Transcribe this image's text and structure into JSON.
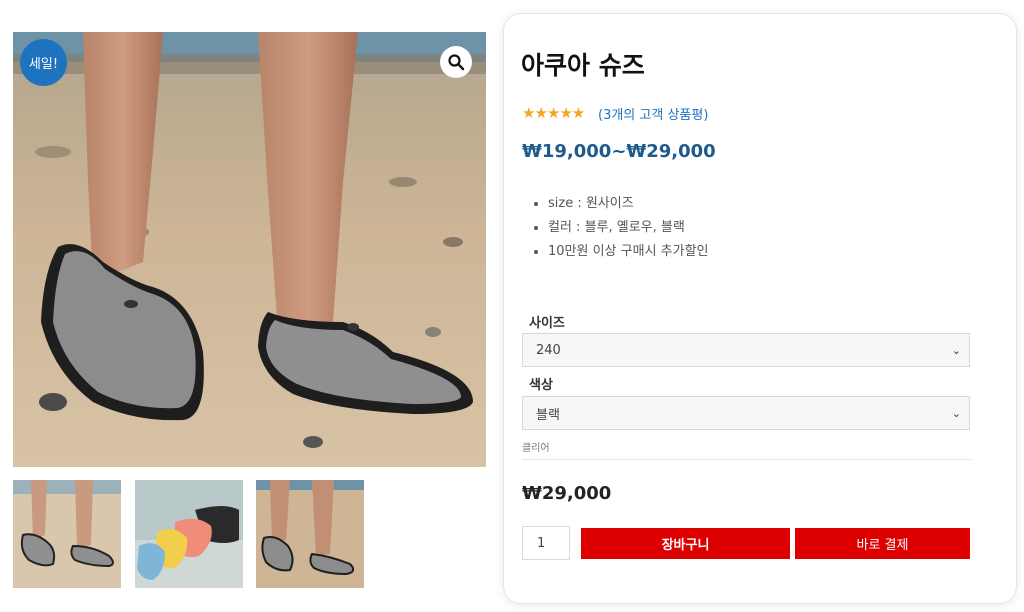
{
  "gallery": {
    "sale_badge": "세일!",
    "zoom_icon": "magnifier-icon",
    "main_image_alt": "aqua-shoes-beach-photo",
    "thumbnails": [
      "thumb-1",
      "thumb-2",
      "thumb-3"
    ]
  },
  "product": {
    "title": "아쿠아 슈즈",
    "rating": {
      "stars": "★★★★★",
      "value": 5,
      "max": 5,
      "review_text": "(3개의 고객 상품평)"
    },
    "price_range": "₩19,000~₩29,000",
    "features": [
      "size : 원사이즈",
      "컬러 : 블루, 옐로우, 블랙",
      "10만원 이상 구매시 추가할인"
    ]
  },
  "variations": {
    "size_label": "사이즈",
    "size_value": "240",
    "color_label": "색상",
    "color_value": "블랙",
    "clear_label": "클리어"
  },
  "purchase": {
    "price": "₩29,000",
    "quantity": "1",
    "cart_button": "장바구니",
    "buy_button": "바로 결제"
  },
  "colors": {
    "accent_blue": "#1e73be",
    "button_red": "#dd0000",
    "star": "#f5a623"
  }
}
